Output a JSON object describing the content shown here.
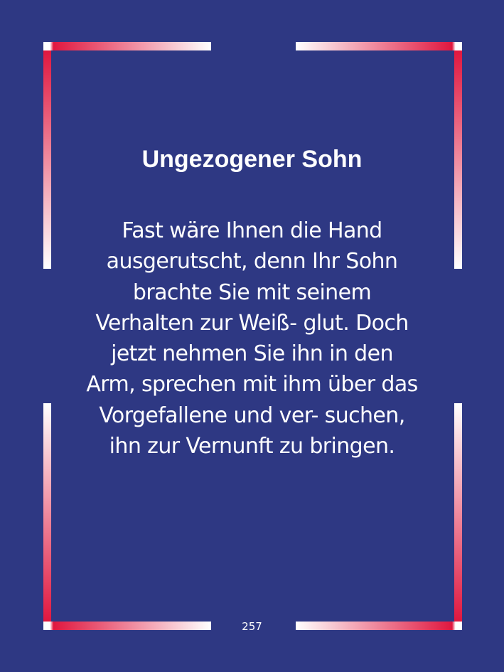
{
  "title": "Ungezogener Sohn",
  "body_lines": [
    "Fast wäre Ihnen die Hand",
    "ausgerutscht, denn Ihr Sohn",
    "brachte Sie mit seinem",
    "Verhalten zur Weiß- glut. Doch",
    "jetzt nehmen Sie ihn in den",
    "Arm, sprechen mit ihm über das",
    "Vorgefallene und ver- suchen,",
    "ihn zur Vernunft zu bringen."
  ],
  "page_number": "257",
  "colors": {
    "background": "#2e3883",
    "frame_accent": "#e0173f",
    "frame_light": "#ffffff",
    "text": "#ffffff"
  }
}
